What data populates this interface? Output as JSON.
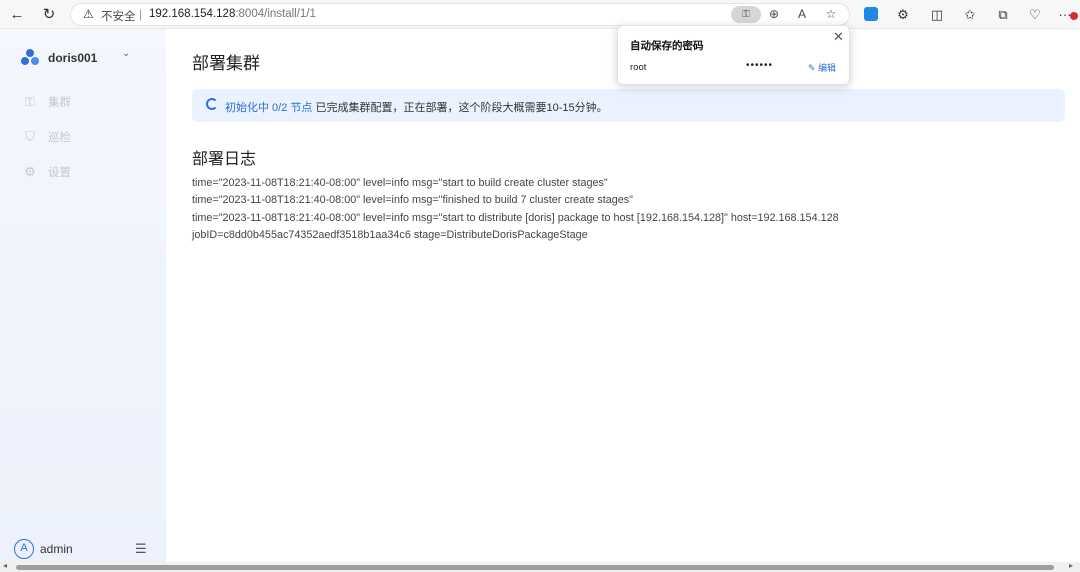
{
  "browser": {
    "back_icon": "←",
    "reload_icon": "↻",
    "insecure_label": "不安全",
    "url_host": "192.168.154.128",
    "url_rest": ":8004/install/1/1",
    "zoom_icon": "zoom-in-icon",
    "read_aloud_label": "A",
    "more_label": "···"
  },
  "popup": {
    "title": "自动保存的密码",
    "close": "✕",
    "username": "root",
    "password": "••••••",
    "edit_label": "编辑"
  },
  "sidebar": {
    "cluster_name": "doris001",
    "items": [
      {
        "label": "集群"
      },
      {
        "label": "巡检"
      },
      {
        "label": "设置"
      }
    ],
    "user": {
      "avatar_letter": "A",
      "name": "admin"
    }
  },
  "main": {
    "title": "部署集群",
    "alert": {
      "status": "初始化中 0/2 节点",
      "message": "已完成集群配置，正在部署，这个阶段大概需要10-15分钟。"
    },
    "log_title": "部署日志",
    "log_lines": [
      "time=\"2023-11-08T18:21:40-08:00\" level=info msg=\"start to build create cluster stages\"",
      "time=\"2023-11-08T18:21:40-08:00\" level=info msg=\"finished to build 7 cluster create stages\"",
      "time=\"2023-11-08T18:21:40-08:00\" level=info msg=\"start to distribute [doris] package to host [192.168.154.128]\" host=192.168.154.128",
      "jobID=c8dd0b455ac74352aedf3518b1aa34c6 stage=DistributeDorisPackageStage"
    ]
  },
  "colors": {
    "accent": "#2f6fd6",
    "alert_bg": "#e9f2fe",
    "sidebar_bg": "#f0f4fc"
  }
}
